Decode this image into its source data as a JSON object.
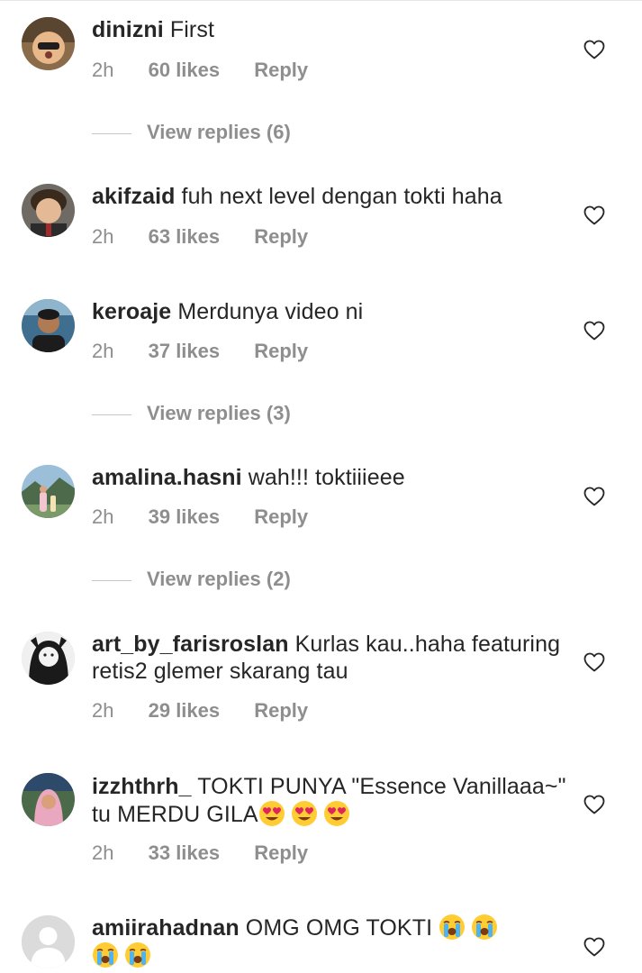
{
  "comments": [
    {
      "username": "dinizni",
      "text": "First",
      "time": "2h",
      "likes": "60 likes",
      "reply": "Reply",
      "view_replies": "View replies (6)"
    },
    {
      "username": "akifzaid",
      "text": "fuh next level dengan tokti haha",
      "time": "2h",
      "likes": "63 likes",
      "reply": "Reply"
    },
    {
      "username": "keroaje",
      "text": "Merdunya video ni",
      "time": "2h",
      "likes": "37 likes",
      "reply": "Reply",
      "view_replies": "View replies (3)"
    },
    {
      "username": "amalina.hasni",
      "text": "wah!!! toktiiieee",
      "time": "2h",
      "likes": "39 likes",
      "reply": "Reply",
      "view_replies": "View replies (2)"
    },
    {
      "username": "art_by_farisroslan",
      "text": "Kurlas kau..haha featuring retis2 glemer skarang tau",
      "time": "2h",
      "likes": "29 likes",
      "reply": "Reply"
    },
    {
      "username": "izzhthrh_",
      "text": "TOKTI PUNYA \"Essence Vanillaaa~\" tu MERDU GILA",
      "time": "2h",
      "likes": "33 likes",
      "reply": "Reply"
    },
    {
      "username": "amiirahadnan",
      "text": "OMG OMG TOKTI",
      "time": "",
      "likes": "",
      "reply": ""
    }
  ],
  "icons": {
    "heart": "heart-outline-icon",
    "heart_eyes": "heart-eyes-emoji",
    "crying": "loudly-crying-emoji"
  },
  "colors": {
    "text": "#262626",
    "secondary": "#8e8e8e",
    "divider": "#c7c7c7"
  }
}
